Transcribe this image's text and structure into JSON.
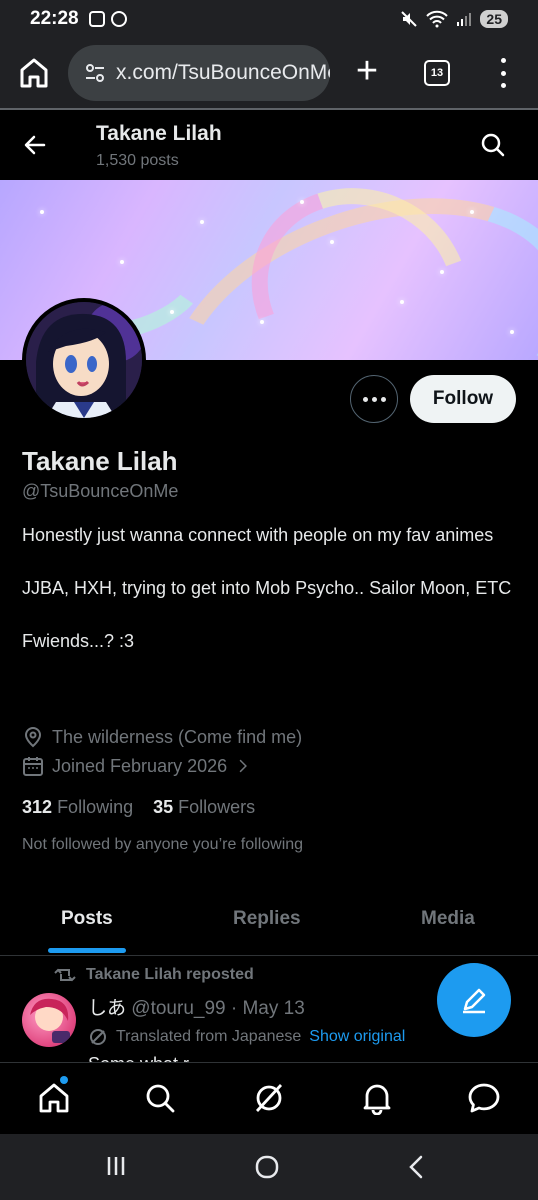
{
  "status_bar": {
    "time": "22:28",
    "battery": "25"
  },
  "browser": {
    "url": "x.com/TsuBounceOnMe",
    "tab_count": "13"
  },
  "header": {
    "title": "Takane Lilah",
    "post_count": "1,530 posts"
  },
  "profile": {
    "display_name": "Takane Lilah",
    "handle": "@TsuBounceOnMe",
    "follow_label": "Follow",
    "bio": [
      "Honestly just wanna connect with people on my fav animes",
      "JJBA, HXH, trying to get into Mob Psycho.. Sailor Moon, ETC",
      "Fwiends...? :3"
    ],
    "location": "The wilderness (Come find me)",
    "joined": "Joined February 2026",
    "following_count": "312",
    "following_label": "Following",
    "followers_count": "35",
    "followers_label": "Followers",
    "not_followed": "Not followed by anyone you’re following"
  },
  "tabs": [
    {
      "label": "Posts"
    },
    {
      "label": "Replies"
    },
    {
      "label": "Media"
    }
  ],
  "post": {
    "repost_label": "Takane Lilah reposted",
    "author_name": "しあ",
    "author_handle": "@touru_99 · May 13",
    "translated_label": "Translated from Japanese",
    "show_original": "Show original",
    "text_peek": "Some what r"
  },
  "colors": {
    "accent": "#1d9bf0",
    "background": "#000000",
    "muted": "#71767b"
  }
}
